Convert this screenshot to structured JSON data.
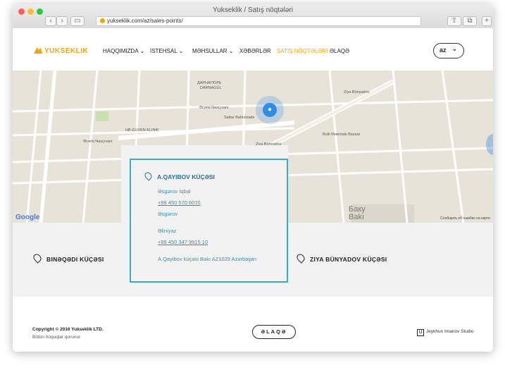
{
  "browser": {
    "window_title": "Yukseklik / Satış nöqtələri",
    "url": "yukseklik.com/az/sales-points/",
    "back_glyph": "‹",
    "forward_glyph": "›",
    "sidebar_glyph": "▭",
    "share_glyph": "⇧",
    "tabs_glyph": "⧉",
    "newtab_glyph": "+"
  },
  "header": {
    "logo_text": "YUKSEKLIK",
    "menu": [
      {
        "label": "HAQQIMIZDA ⌄"
      },
      {
        "label": "İSTEHSAL ⌄"
      },
      {
        "label": "MƏHSULLAR ⌄"
      },
      {
        "label": "XƏBƏRLƏR"
      },
      {
        "label": "SATIŞ NÖQTƏLƏRİ",
        "active": true
      },
      {
        "label": "ƏLAQƏ"
      }
    ],
    "language": "az",
    "language_chevron": "⌄"
  },
  "map": {
    "labels": [
      "ДАРНАГЮЛЬ",
      "DARNAGÜL",
      "Ziya Bünyadov",
      "Bulk Materials Bazaar",
      "HB GUVEN KLINIK",
      "Sattar Bahlulzade",
      "Ziya Bünyadov",
      "Əcəmi Naxçıvani",
      "Bakı",
      "Баку",
      "Əcəmi Naxçıvani"
    ],
    "baku_ru": "Баку",
    "baku_az": "Bakı",
    "google": "Google",
    "note": "Сообщить об ошибке на карте",
    "pin_glyph": "●"
  },
  "points": [
    {
      "name": "BINƏQƏDI KÜÇƏSI"
    },
    {
      "name": "ZIYA BÜNYADOV KÜÇƏSI"
    }
  ],
  "card": {
    "title": "A.QAYIBOV KÜÇƏSI",
    "lines": [
      {
        "text": "Əsgərov İqbal"
      },
      {
        "text": "+99 450 570 6070"
      },
      {
        "text": "Əsgərov"
      },
      {
        "text": "Əliniyaz"
      },
      {
        "text": "+99 450 347 9915 10"
      },
      {
        "text": "A.Qayibov küçəsi Bakı AZ1029 Azərbaijan"
      }
    ]
  },
  "footer": {
    "copyright": "Copyright © 2016 Yukseklik LTD.",
    "rights": "Bütün hüquqlar qorunur",
    "contact_button": "ƏLAQƏ",
    "studio": "Jeykhun Imanov Studio",
    "studio_mark": "U"
  },
  "colors": {
    "accent": "#f0a500",
    "card_border": "#35aecb",
    "pin": "#2e8de6"
  }
}
